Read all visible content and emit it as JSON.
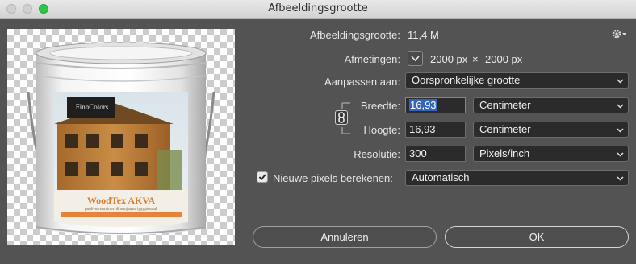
{
  "window": {
    "title": "Afbeeldingsgrootte"
  },
  "image_size": {
    "label": "Afbeeldingsgrootte:",
    "value": "11,4 M"
  },
  "dimensions": {
    "label": "Afmetingen:",
    "width": "2000 px",
    "separator": "×",
    "height": "2000 px"
  },
  "fit_to": {
    "label": "Aanpassen aan:",
    "value": "Oorspronkelijke grootte"
  },
  "width": {
    "label": "Breedte:",
    "value": "16,93",
    "unit": "Centimeter"
  },
  "height": {
    "label": "Hoogte:",
    "value": "16,93",
    "unit": "Centimeter"
  },
  "resolution": {
    "label": "Resolutie:",
    "value": "300",
    "unit": "Pixels/inch"
  },
  "resample": {
    "label": "Nieuwe pixels berekenen:",
    "checked": true,
    "value": "Automatisch"
  },
  "buttons": {
    "cancel": "Annuleren",
    "ok": "OK"
  },
  "product": {
    "brand": "FinnColors",
    "name": "WoodTex AKVA",
    "tagline": "puolivahvarainen & suojaava tyyppimaali"
  },
  "icons": {
    "settings": "gear-icon",
    "dimensions_menu": "chevron-down-icon",
    "constrain": "chain-link-icon",
    "checkbox": "checkmark-icon"
  },
  "colors": {
    "dialog_bg": "#535353",
    "field_bg": "#2b2b2b",
    "selection": "#3565b8",
    "label_band": "#e8833a"
  }
}
